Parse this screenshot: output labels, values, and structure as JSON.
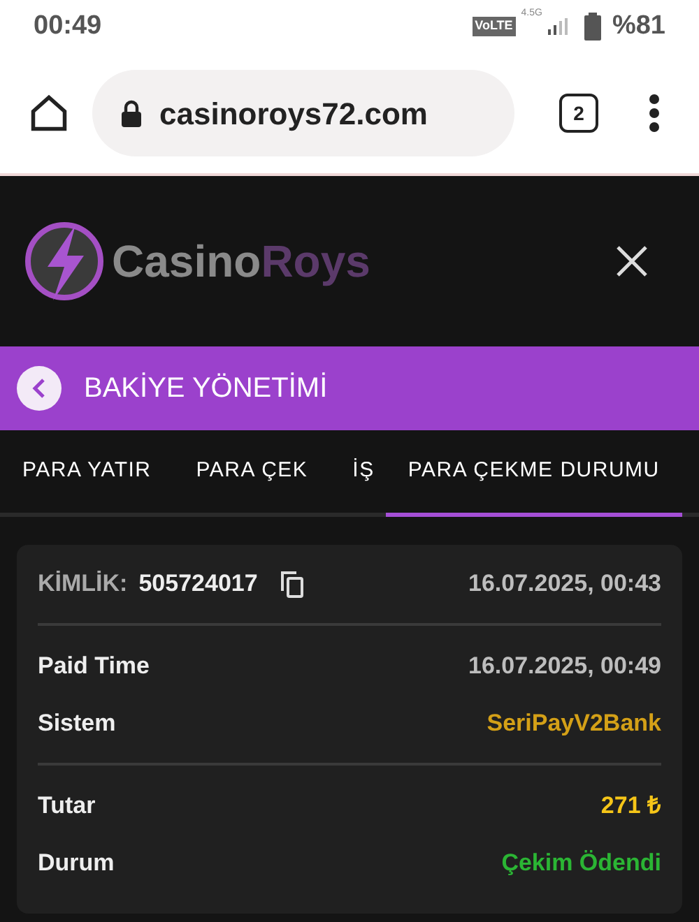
{
  "status_bar": {
    "time": "00:49",
    "volte": "VoLTE",
    "network": "4.5G",
    "battery": "%81"
  },
  "browser": {
    "url": "casinoroys72.com",
    "tab_count": "2"
  },
  "logo": {
    "part_1": "Casino",
    "part_2": "Roys"
  },
  "banner": {
    "title": "BAKİYE YÖNETİMİ"
  },
  "tabs": [
    {
      "label": "PARA YATIR",
      "selected": false
    },
    {
      "label": "PARA ÇEK",
      "selected": false
    },
    {
      "label": "İŞ",
      "selected": false
    },
    {
      "label": "PARA ÇEKME DURUMU",
      "selected": true
    }
  ],
  "card": {
    "id_label": "KİMLİK:",
    "id_value": "505724017",
    "created": "16.07.2025, 00:43",
    "sections": [
      [
        {
          "label": "Paid Time",
          "value": "16.07.2025, 00:49",
          "color": "#bdbdbd"
        },
        {
          "label": "Sistem",
          "value": "SeriPayV2Bank",
          "color": "#d4a017"
        }
      ],
      [
        {
          "label": "Tutar",
          "value": "271 ₺",
          "color": "#f5c518"
        },
        {
          "label": "Durum",
          "value": "Çekim Ödendi",
          "color": "#2bb534"
        }
      ]
    ]
  }
}
